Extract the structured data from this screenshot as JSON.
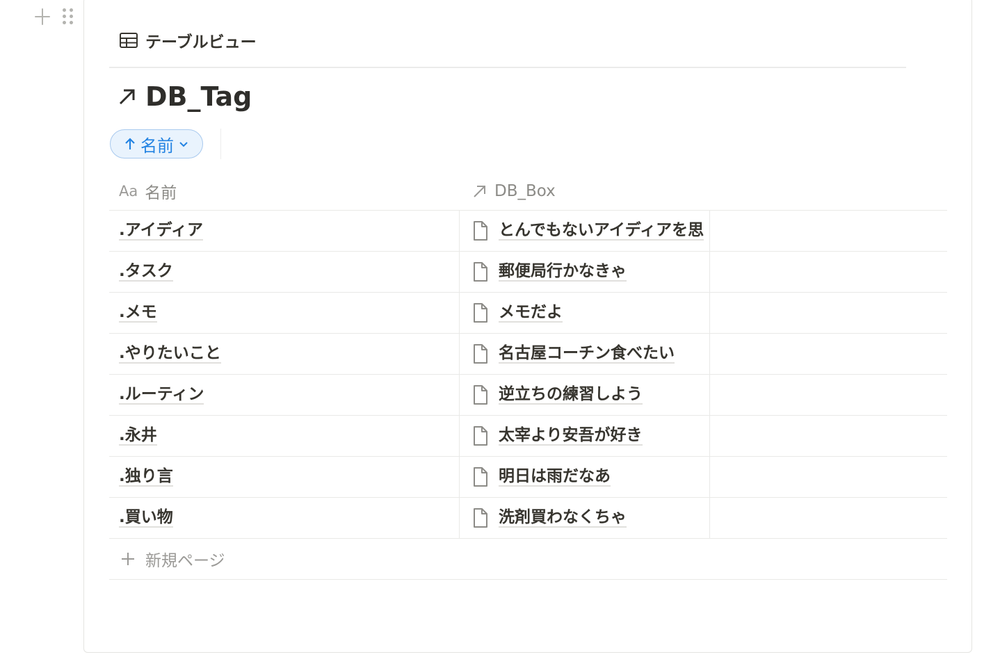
{
  "view": {
    "tab_label": "テーブルビュー"
  },
  "database": {
    "title": "DB_Tag"
  },
  "sort": {
    "label": "名前"
  },
  "table": {
    "columns": [
      {
        "prefix": "Aa",
        "label": "名前"
      },
      {
        "label": "DB_Box"
      }
    ],
    "rows": [
      {
        "name": ".アイディア",
        "box": "とんでもないアイディアを思"
      },
      {
        "name": ".タスク",
        "box": "郵便局行かなきゃ"
      },
      {
        "name": ".メモ",
        "box": "メモだよ"
      },
      {
        "name": ".やりたいこと",
        "box": "名古屋コーチン食べたい"
      },
      {
        "name": ".ルーティン",
        "box": "逆立ちの練習しよう"
      },
      {
        "name": ".永井",
        "box": "太宰より安吾が好き"
      },
      {
        "name": ".独り言",
        "box": "明日は雨だなあ"
      },
      {
        "name": ".買い物",
        "box": "洗剤買わなくちゃ"
      }
    ],
    "new_page_label": "新規ページ"
  },
  "colors": {
    "accent": "#2383e2",
    "text": "#37352f",
    "muted": "#9b9a97",
    "border": "#e9e9e7"
  }
}
